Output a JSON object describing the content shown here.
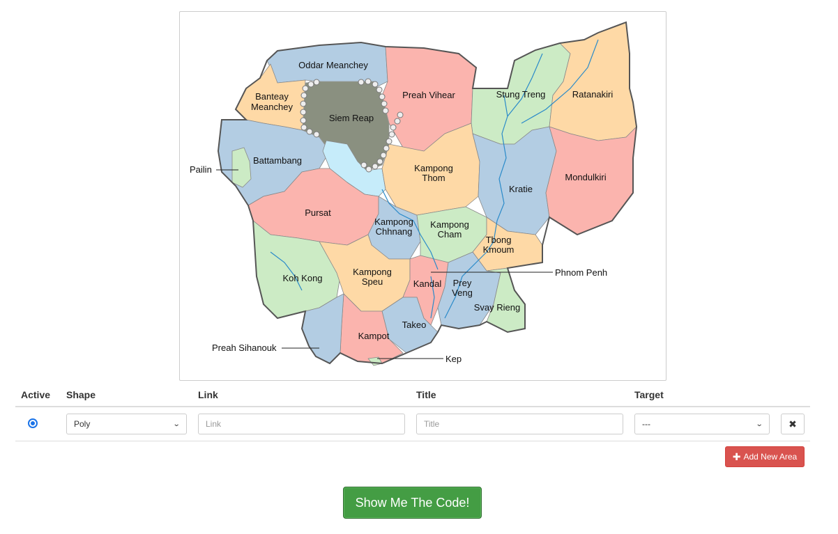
{
  "map": {
    "provinces": {
      "oddar_meanchey": "Oddar Meanchey",
      "banteay_meanchey_1": "Banteay",
      "banteay_meanchey_2": "Meanchey",
      "siem_reap": "Siem Reap",
      "preah_vihear": "Preah Vihear",
      "stung_treng": "Stung Treng",
      "ratanakiri": "Ratanakiri",
      "battambang": "Battambang",
      "pailin": "Pailin",
      "kampong_thom_1": "Kampong",
      "kampong_thom_2": "Thom",
      "kratie": "Kratie",
      "mondulkiri": "Mondulkiri",
      "pursat": "Pursat",
      "kampong_chhnang_1": "Kampong",
      "kampong_chhnang_2": "Chhnang",
      "kampong_cham_1": "Kampong",
      "kampong_cham_2": "Cham",
      "tbong_kmoum_1": "Tbong",
      "tbong_kmoum_2": "Kmoum",
      "koh_kong": "Koh Kong",
      "kampong_speu_1": "Kampong",
      "kampong_speu_2": "Speu",
      "kandal": "Kandal",
      "prey_veng_1": "Prey",
      "prey_veng_2": "Veng",
      "phnom_penh": "Phnom Penh",
      "svay_rieng": "Svay Rieng",
      "takeo": "Takeo",
      "kampot": "Kampot",
      "preah_sihanouk": "Preah Sihanouk",
      "kep": "Kep"
    },
    "colors": {
      "blue": "#b3cde3",
      "red": "#fbb4ae",
      "green": "#ccebc5",
      "orange": "#fed9a6",
      "selected": "#8a9080",
      "lake": "#c6ecfa",
      "river": "#2a8ac9",
      "border": "#555555"
    }
  },
  "table": {
    "headers": {
      "active": "Active",
      "shape": "Shape",
      "link": "Link",
      "title": "Title",
      "target": "Target"
    },
    "rows": [
      {
        "shape": "Poly",
        "link_placeholder": "Link",
        "title_placeholder": "Title",
        "target": "---"
      }
    ]
  },
  "buttons": {
    "add_area": "Add New Area",
    "show_code": "Show Me The Code!"
  }
}
